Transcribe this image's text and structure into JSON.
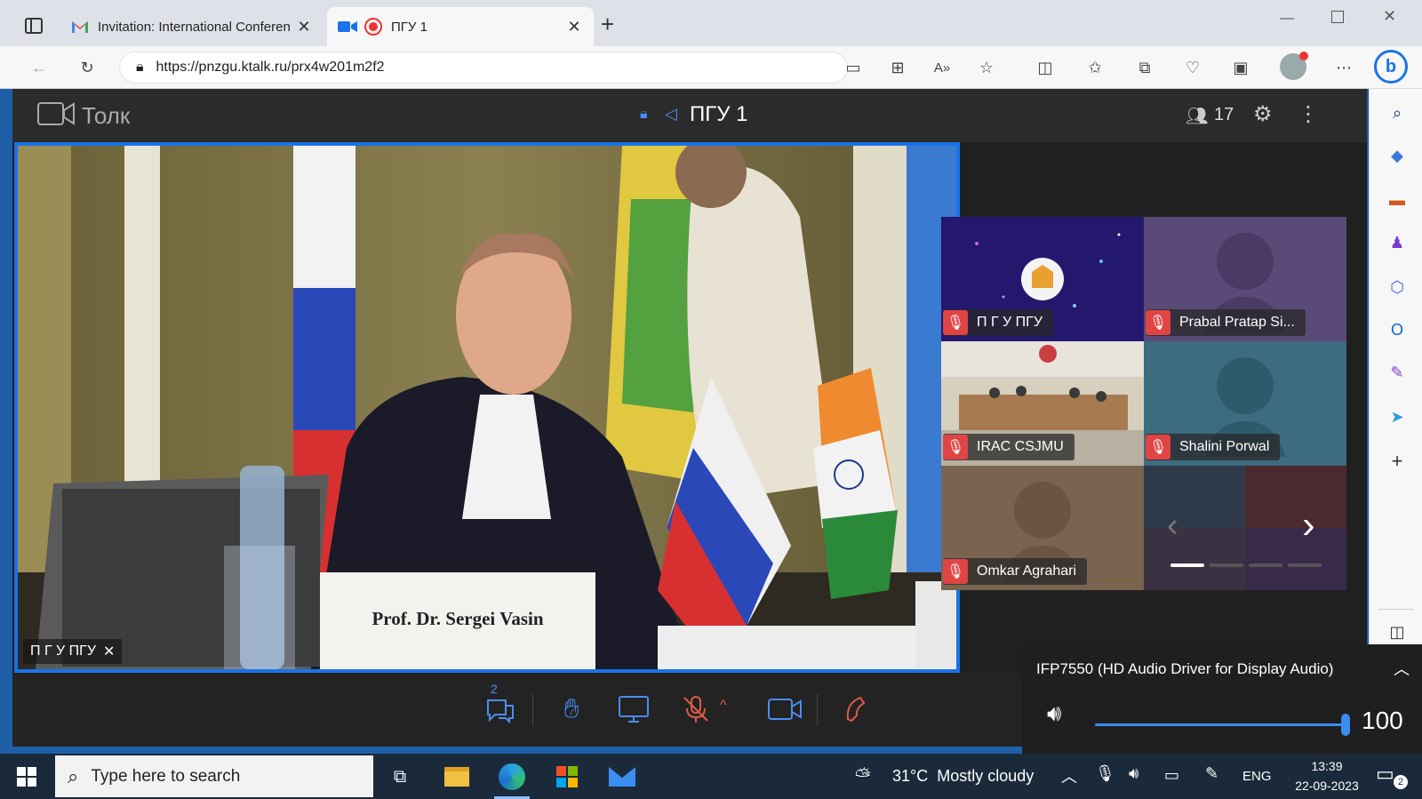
{
  "browser": {
    "tabs": [
      {
        "title": "Invitation: International Conferen",
        "icon": "gmail-icon",
        "active": false
      },
      {
        "title": "ПГУ 1",
        "icon": "video-recording-icon",
        "active": true
      }
    ],
    "new_tab": "+",
    "url": "https://pnzgu.ktalk.ru/prx4w201m2f2"
  },
  "app": {
    "brand": "Толк",
    "room_title": "ПГУ 1",
    "participants_count": "17",
    "main_speaker_label": "П Г У ПГУ",
    "name_plate": "Prof. Dr. Sergei Vasin",
    "tiles": [
      {
        "name": "П Г У ПГУ",
        "bg": "#2a1e78",
        "type": "logo"
      },
      {
        "name": "Prabal Pratap Si...",
        "bg": "#5a4a78",
        "type": "silhouette"
      },
      {
        "name": "IRAC CSJMU",
        "bg": "#cfc7b5",
        "type": "room"
      },
      {
        "name": "Shalini Porwal",
        "bg": "#3d6b80",
        "type": "silhouette"
      },
      {
        "name": "Omkar Agrahari",
        "bg": "#7a6450",
        "type": "silhouette"
      }
    ],
    "pager_pages": 4,
    "pager_active": 0,
    "chat_badge": "2"
  },
  "audio_popup": {
    "device": "IFP7550 (HD Audio Driver for Display Audio)",
    "volume": 100,
    "volume_label": "100"
  },
  "taskbar": {
    "search_placeholder": "Type here to search",
    "weather": "31°C  Mostly cloudy",
    "language": "ENG",
    "time": "13:39",
    "date": "22-09-2023",
    "notifications": "2"
  },
  "colors": {
    "accent": "#1a73e8",
    "mute_red": "#e04444",
    "hangup": "#e05a4a"
  }
}
